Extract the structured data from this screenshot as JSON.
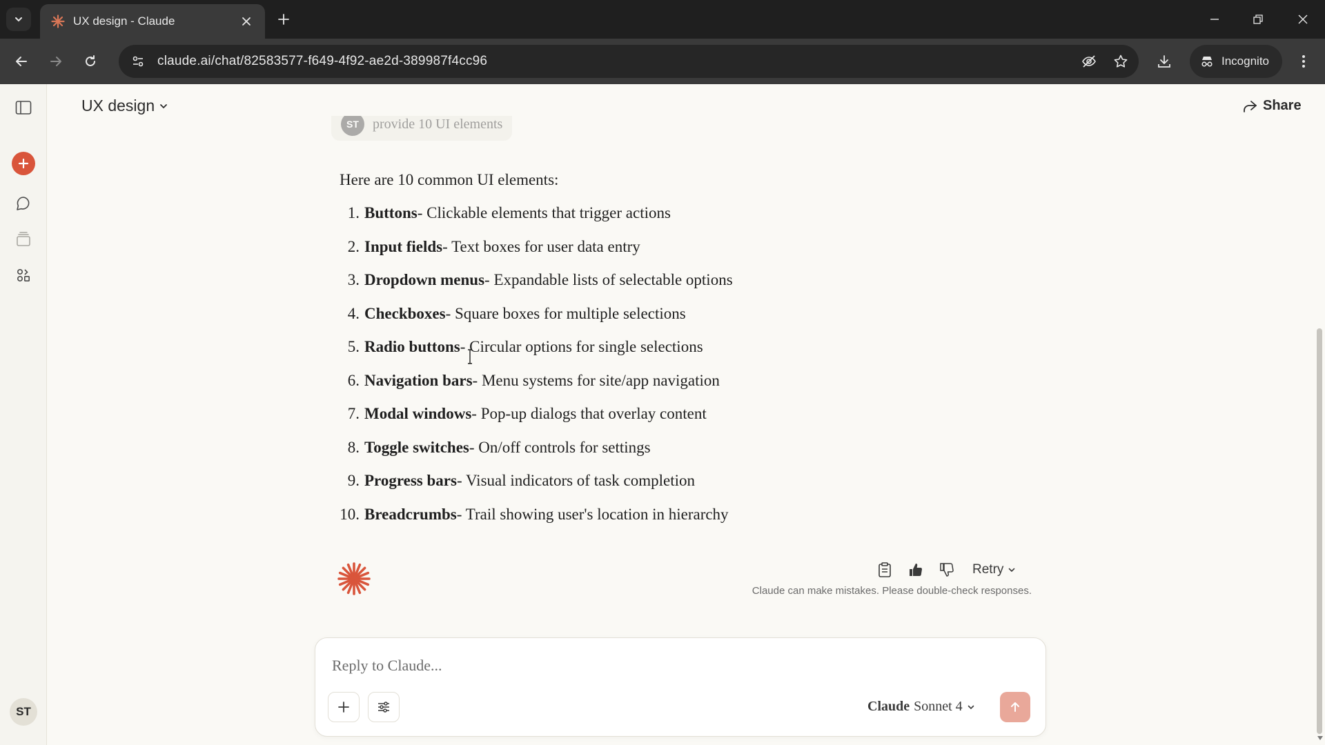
{
  "browser": {
    "tab_title": "UX design - Claude",
    "url": "claude.ai/chat/82583577-f649-4f92-ae2d-389987f4cc96",
    "incognito_label": "Incognito"
  },
  "header": {
    "chat_title": "UX design",
    "share_label": "Share"
  },
  "user_message": {
    "avatar_initials": "ST",
    "text": "provide 10 UI elements"
  },
  "answer": {
    "intro": "Here are 10 common UI elements:",
    "items": [
      {
        "num": "1.",
        "name": "Buttons",
        "desc": " - Clickable elements that trigger actions"
      },
      {
        "num": "2.",
        "name": "Input fields",
        "desc": " - Text boxes for user data entry"
      },
      {
        "num": "3.",
        "name": "Dropdown menus",
        "desc": " - Expandable lists of selectable options"
      },
      {
        "num": "4.",
        "name": "Checkboxes",
        "desc": " - Square boxes for multiple selections"
      },
      {
        "num": "5.",
        "name": "Radio buttons",
        "desc": " - Circular options for single selections"
      },
      {
        "num": "6.",
        "name": "Navigation bars",
        "desc": " - Menu systems for site/app navigation"
      },
      {
        "num": "7.",
        "name": "Modal windows",
        "desc": " - Pop-up dialogs that overlay content"
      },
      {
        "num": "8.",
        "name": "Toggle switches",
        "desc": " - On/off controls for settings"
      },
      {
        "num": "9.",
        "name": "Progress bars",
        "desc": " - Visual indicators of task completion"
      },
      {
        "num": "10.",
        "name": "Breadcrumbs",
        "desc": " - Trail showing user's location in hierarchy"
      }
    ]
  },
  "response_actions": {
    "retry_label": "Retry",
    "disclaimer": "Claude can make mistakes. Please double-check responses."
  },
  "composer": {
    "placeholder": "Reply to Claude...",
    "model_brand": "Claude",
    "model_version": "Sonnet 4"
  },
  "sidebar": {
    "avatar_initials": "ST"
  },
  "colors": {
    "brand_accent": "#d9553b",
    "page_background": "#faf9f5",
    "chrome_dark": "#1f1f1f",
    "send_button": "#e9a89a"
  }
}
